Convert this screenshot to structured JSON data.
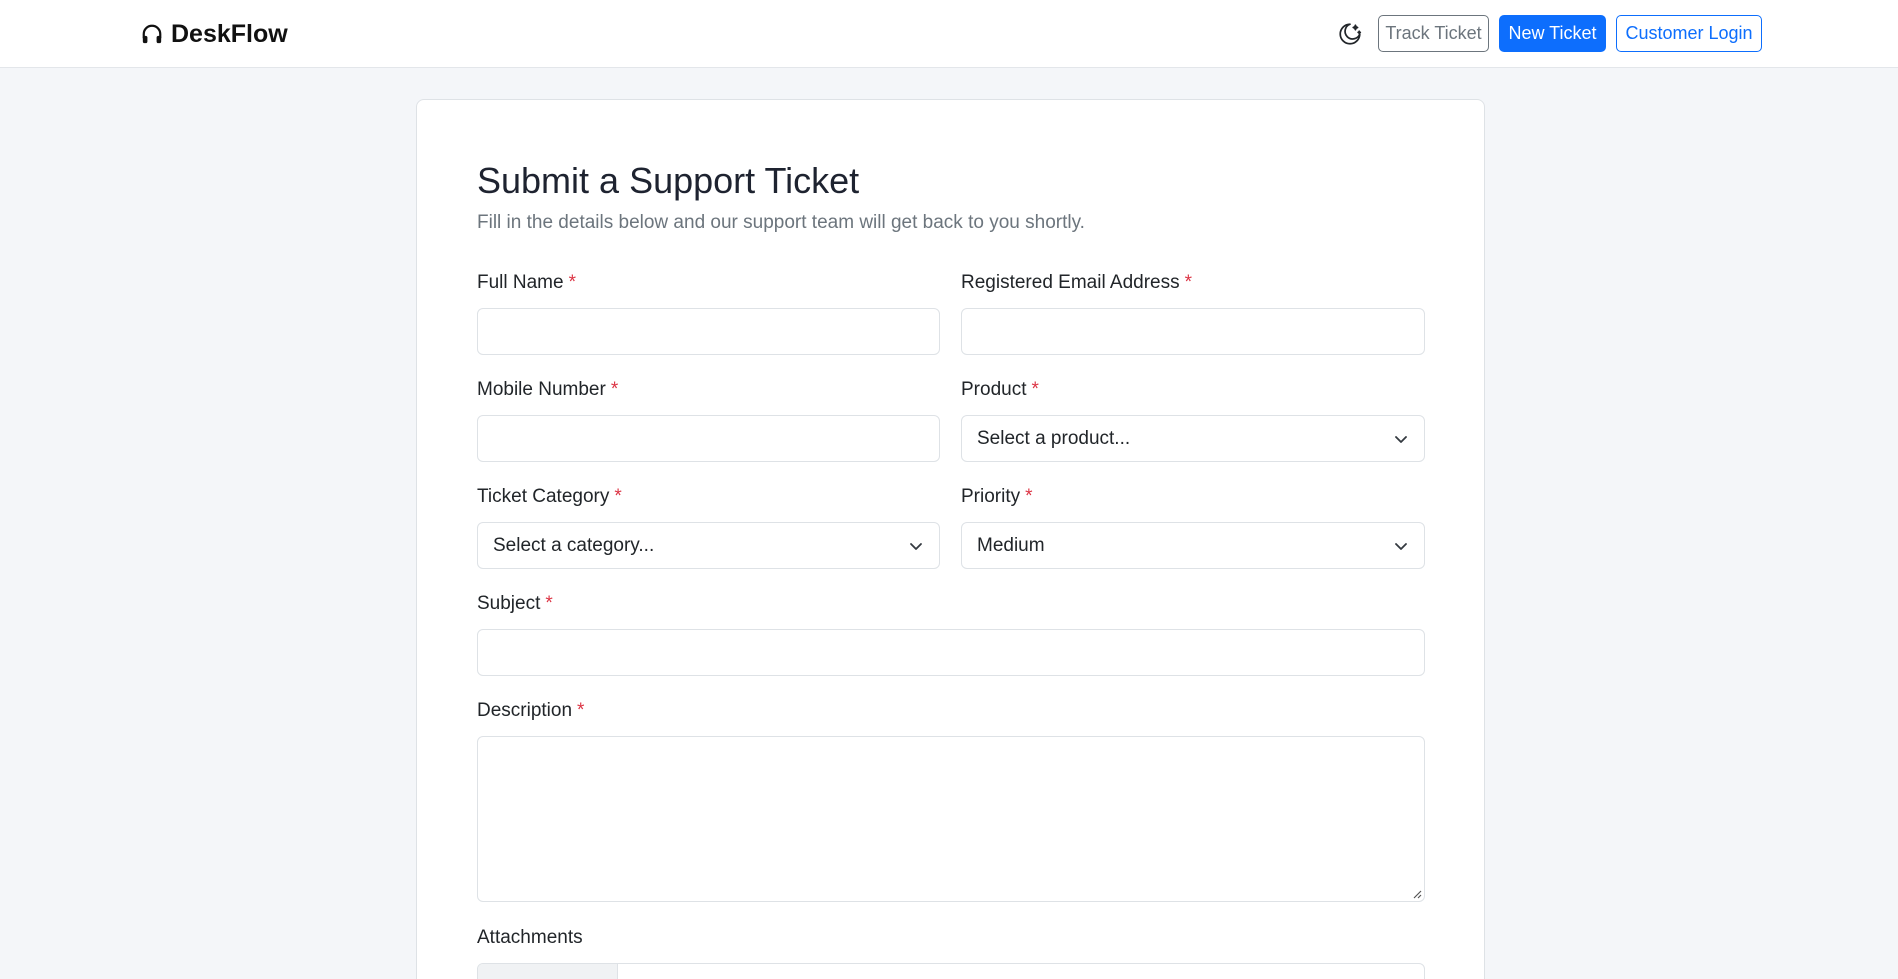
{
  "brand": {
    "name": "DeskFlow",
    "icon": "headphones-icon"
  },
  "nav": {
    "theme_icon": "moon-stars-icon",
    "track_label": "Track Ticket",
    "new_label": "New Ticket",
    "login_label": "Customer Login"
  },
  "form": {
    "title": "Submit a Support Ticket",
    "subtitle": "Fill in the details below and our support team will get back to you shortly.",
    "required_mark": "*",
    "full_name": {
      "label": "Full Name",
      "value": ""
    },
    "email": {
      "label": "Registered Email Address",
      "value": ""
    },
    "mobile": {
      "label": "Mobile Number",
      "value": ""
    },
    "product": {
      "label": "Product",
      "selected": "Select a product..."
    },
    "category": {
      "label": "Ticket Category",
      "selected": "Select a category..."
    },
    "priority": {
      "label": "Priority",
      "selected": "Medium"
    },
    "subject": {
      "label": "Subject",
      "value": ""
    },
    "description": {
      "label": "Description",
      "value": ""
    },
    "attachments": {
      "label": "Attachments"
    }
  },
  "colors": {
    "primary": "#0d6efd",
    "secondary": "#6c757d",
    "required": "#dc3545",
    "page_bg": "#f4f6f9"
  }
}
